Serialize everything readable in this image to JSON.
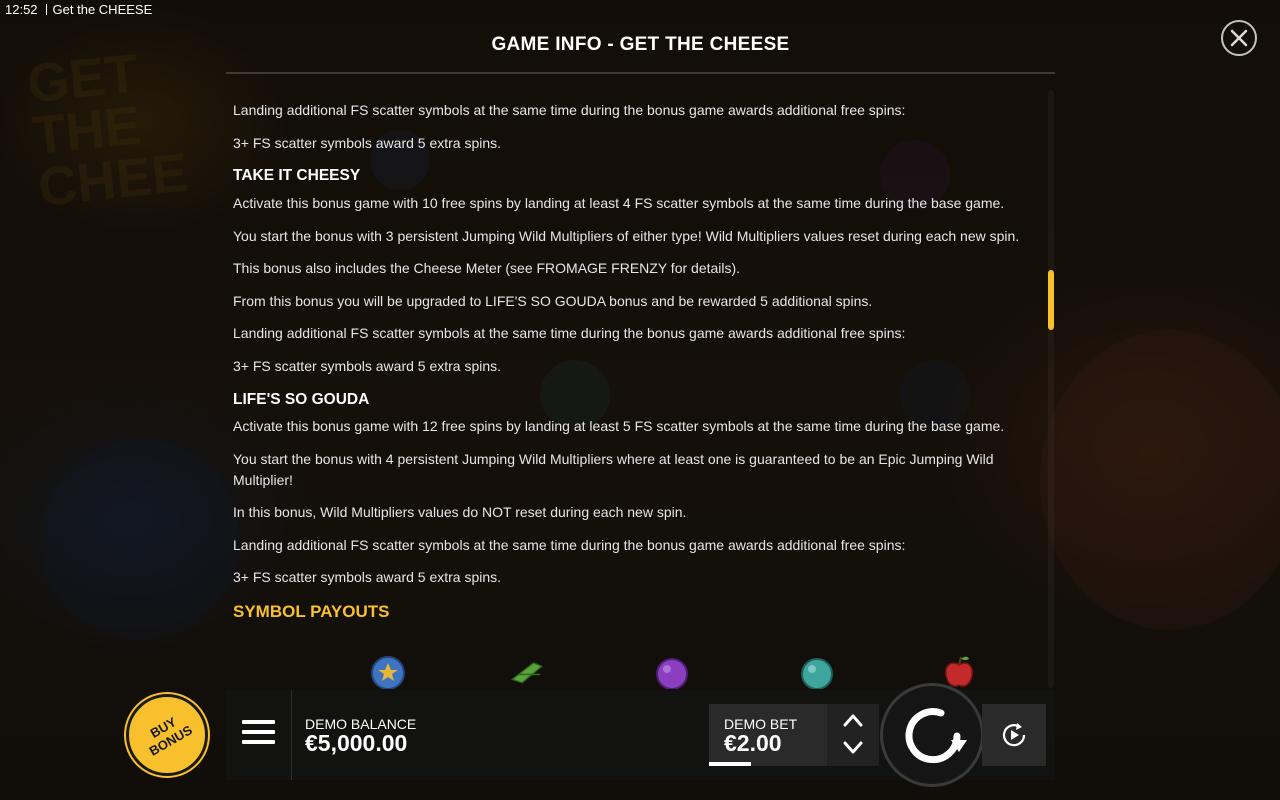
{
  "status": {
    "time": "12:52",
    "app_title": "Get the CHEESE"
  },
  "panel": {
    "title": "GAME INFO - GET THE CHEESE",
    "content": {
      "p1": "Landing additional FS scatter symbols at the same time during the bonus game awards additional free spins:",
      "p2": "3+ FS scatter symbols award 5 extra spins.",
      "h_take_it_cheesy": "TAKE IT CHEESY",
      "p3": "Activate this bonus game with 10 free spins by landing at least 4 FS scatter symbols at the same time during the base game.",
      "p4": "You start the bonus with 3 persistent Jumping Wild Multipliers of either type! Wild Multipliers values reset during each new spin.",
      "p5": "This bonus also includes the Cheese Meter (see FROMAGE FRENZY for details).",
      "p6": "From this bonus you will be upgraded to LIFE'S SO GOUDA bonus and be rewarded 5 additional spins.",
      "p7": "Landing additional FS scatter symbols at the same time during the bonus game awards additional free spins:",
      "p8": "3+ FS scatter symbols award 5 extra spins.",
      "h_lifes_so_gouda": "LIFE'S SO GOUDA",
      "p9": "Activate this bonus game with 12 free spins by landing at least 5 FS scatter symbols at the same time during the base game.",
      "p10": "You start the bonus with 4 persistent Jumping Wild Multipliers where at least one is guaranteed to be an Epic Jumping Wild Multiplier!",
      "p11": "In this bonus, Wild Multipliers values do NOT reset during each new spin.",
      "p12": "Landing additional FS scatter symbols at the same time during the bonus game awards additional free spins:",
      "p13": "3+ FS scatter symbols award 5 extra spins.",
      "h_symbol_payouts": "SYMBOL PAYOUTS"
    },
    "symbols": [
      "blue-ball-icon",
      "green-clothespin-icon",
      "purple-ball-icon",
      "teal-ball-icon",
      "red-apple-icon"
    ]
  },
  "bottom_bar": {
    "balance_label": "DEMO BALANCE",
    "balance_value": "€5,000.00",
    "bet_label": "DEMO BET",
    "bet_value": "€2.00",
    "buy_bonus_label_1": "BUY",
    "buy_bonus_label_2": "BONUS"
  },
  "colors": {
    "accent": "#f7c02c",
    "text": "#e6e6e6",
    "bar_bg": "#121212"
  }
}
